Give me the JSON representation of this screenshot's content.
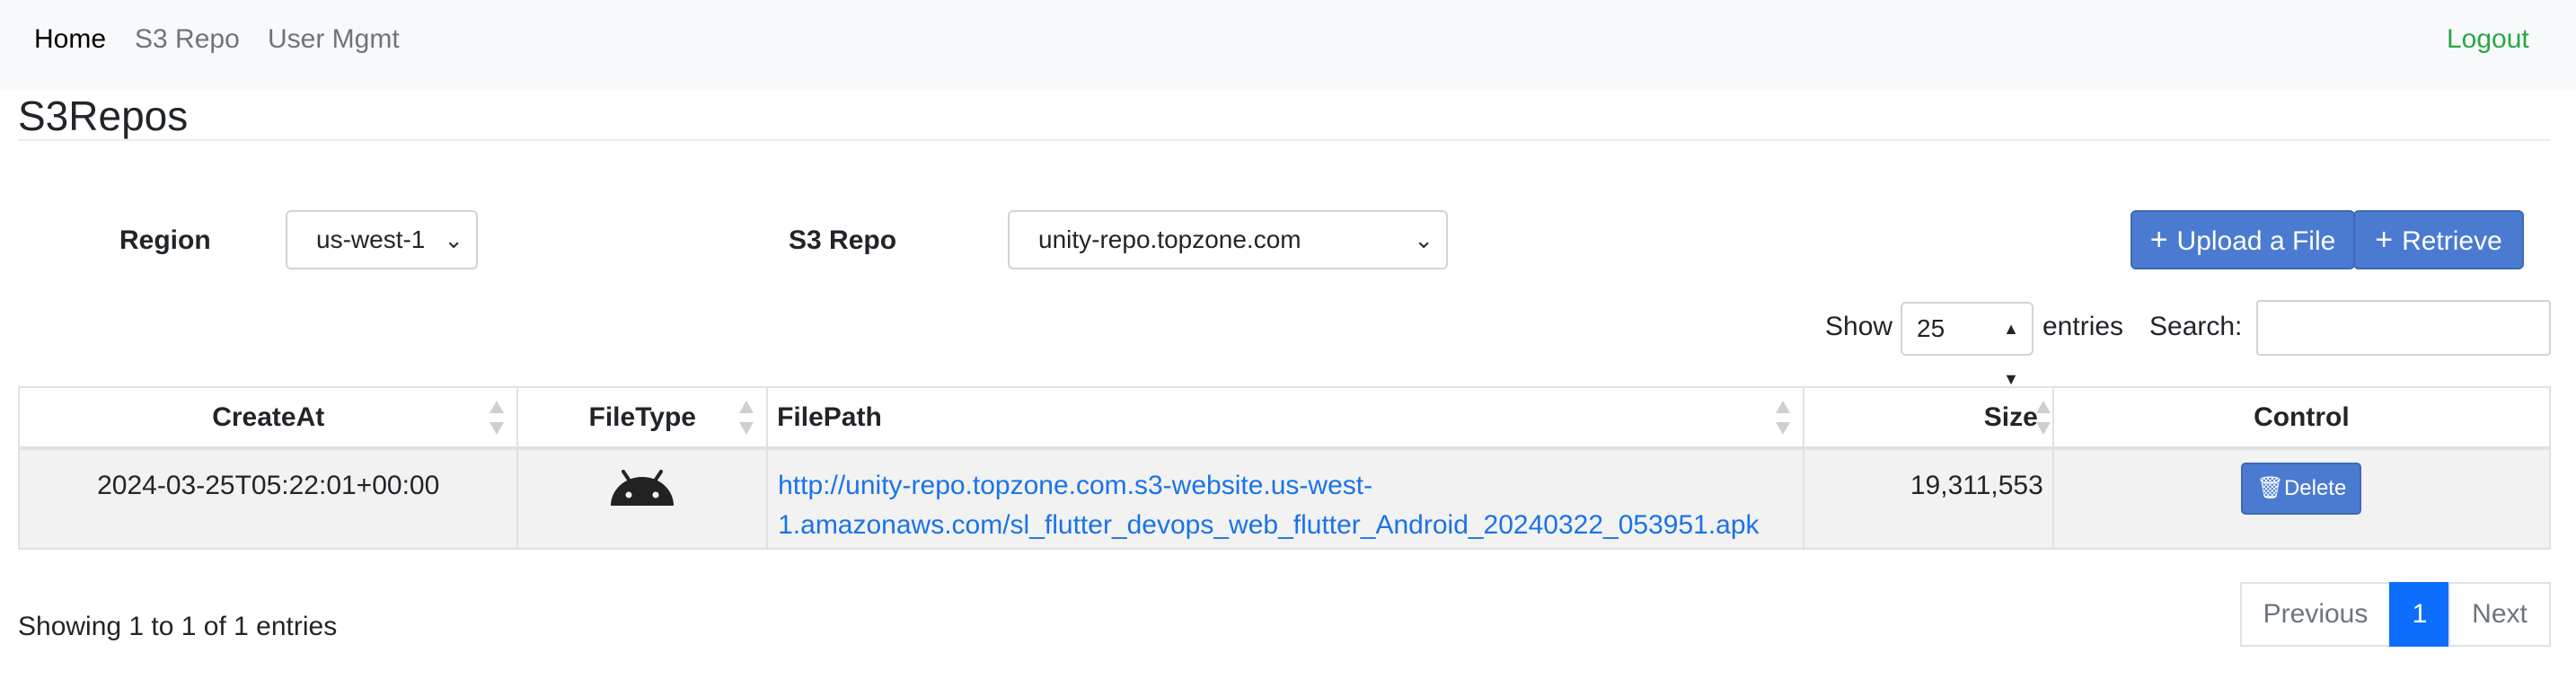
{
  "nav": {
    "home": "Home",
    "s3repo": "S3 Repo",
    "user_mgmt": "User Mgmt",
    "logout": "Logout"
  },
  "page": {
    "title": "S3Repos"
  },
  "filters": {
    "region_label": "Region",
    "region_value": "us-west-1",
    "repo_label": "S3 Repo",
    "repo_value": "unity-repo.topzone.com"
  },
  "actions": {
    "upload_label": "Upload a File",
    "retrieve_label": "Retrieve"
  },
  "table_controls": {
    "show_label": "Show",
    "show_value": "25",
    "entries_label": "entries",
    "search_label": "Search:",
    "search_value": ""
  },
  "table": {
    "columns": [
      "CreateAt",
      "FileType",
      "FilePath",
      "Size",
      "Control"
    ],
    "rows": [
      {
        "create_at": "2024-03-25T05:22:01+00:00",
        "file_type_icon": "android-icon",
        "file_path_line1": "http://unity-repo.topzone.com.s3-website.us-west-",
        "file_path_line2": "1.amazonaws.com/sl_flutter_devops_web_flutter_Android_20240322_053951.apk",
        "size": "19,311,553",
        "control_label": "Delete"
      }
    ]
  },
  "footer": {
    "info": "Showing 1 to 1 of 1 entries",
    "previous": "Previous",
    "current_page": "1",
    "next": "Next"
  },
  "colors": {
    "primary": "#4a7bd0",
    "logout": "#28a745",
    "link": "#1a73e8",
    "page_active": "#0d6efd"
  }
}
